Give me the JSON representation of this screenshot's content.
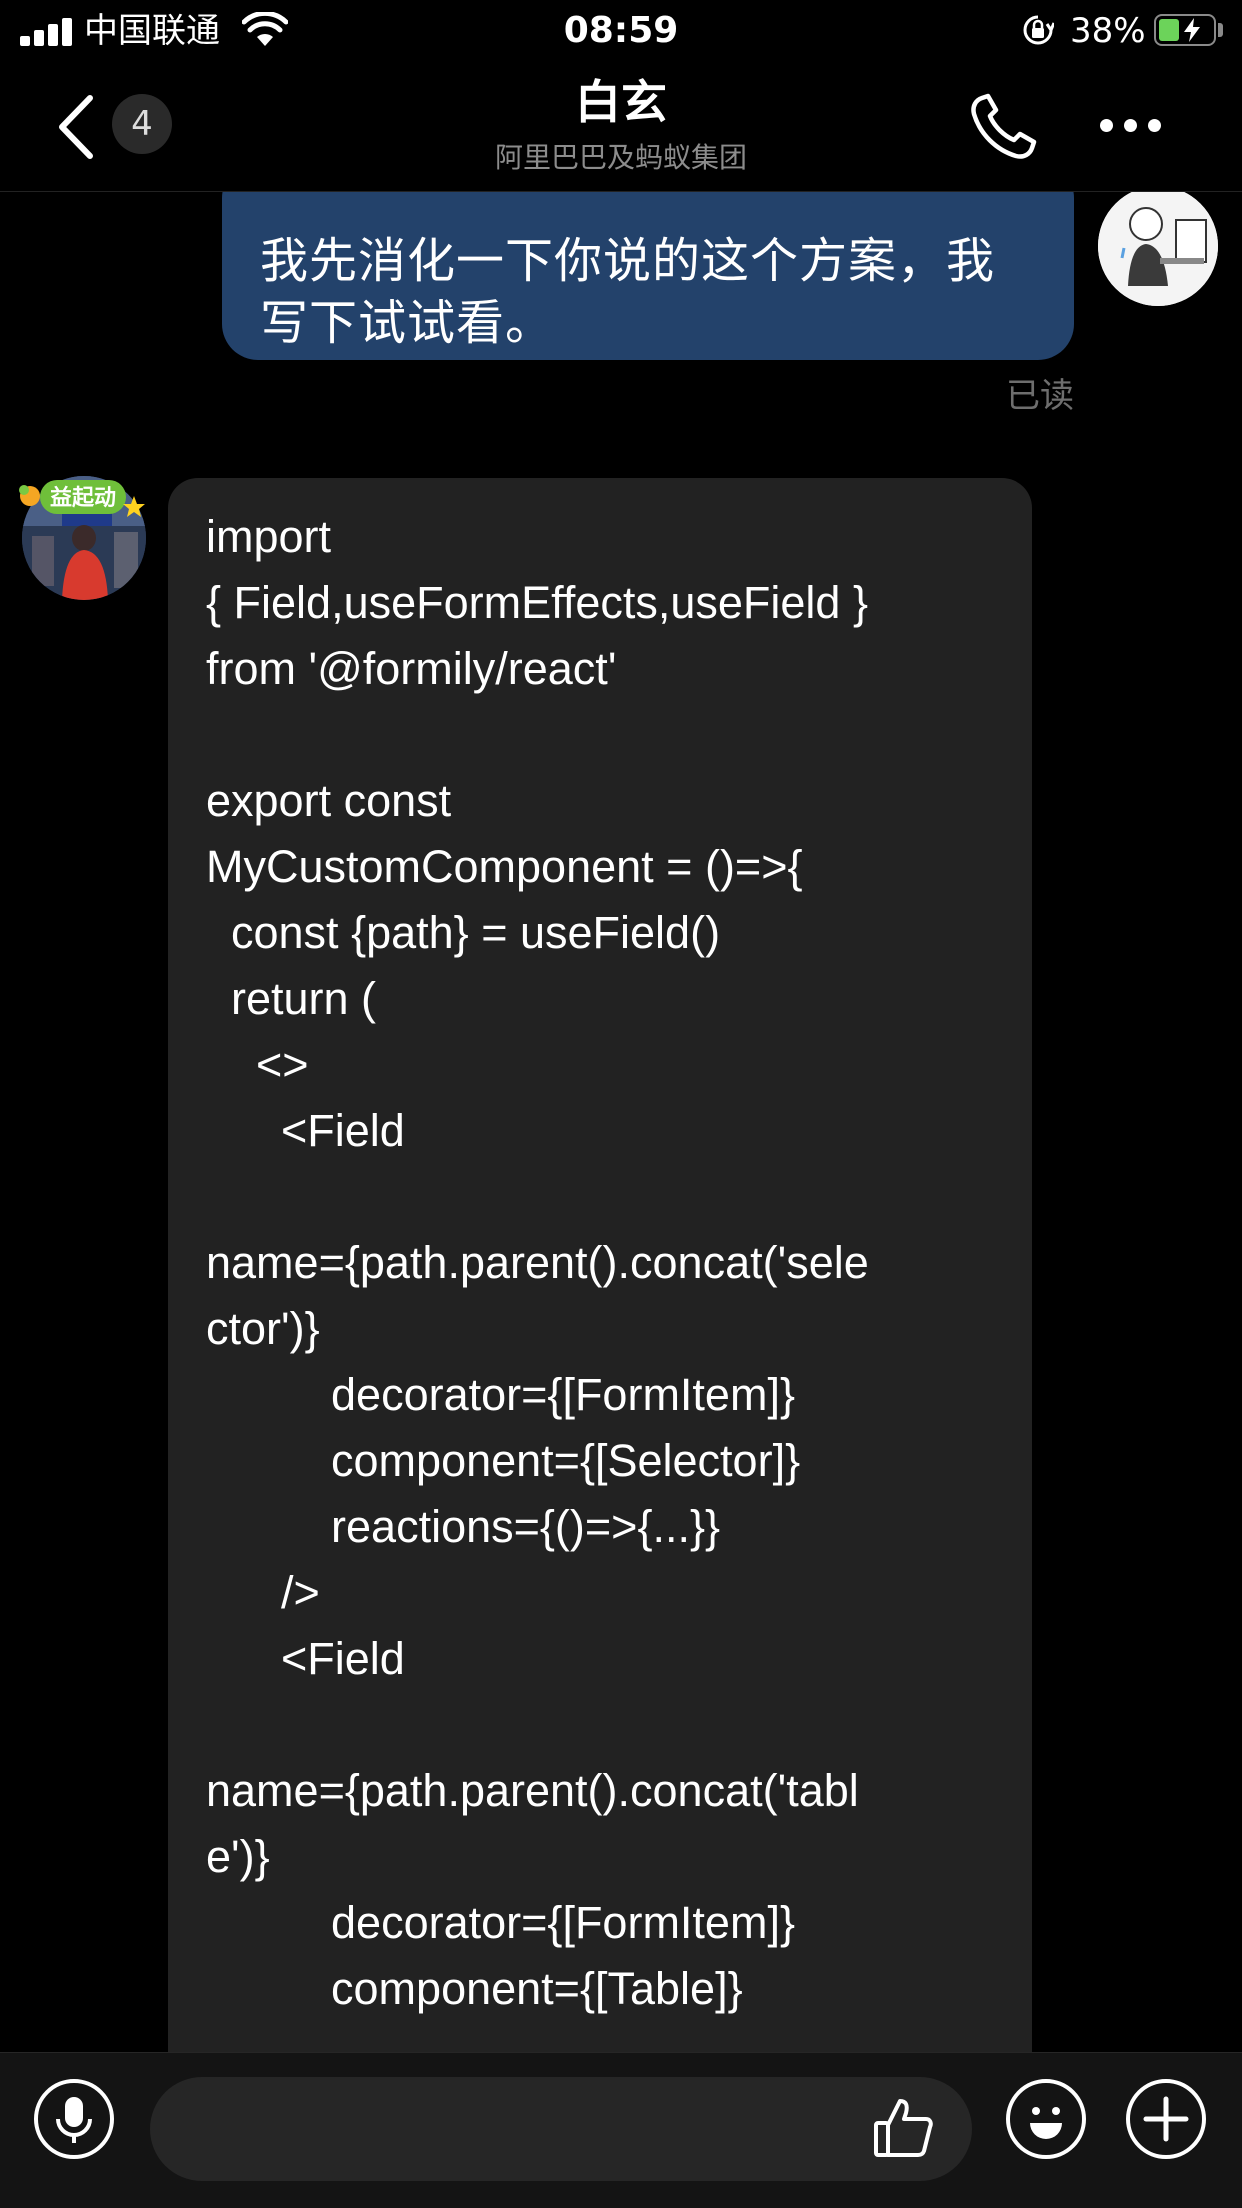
{
  "status_bar": {
    "carrier": "中国联通",
    "time": "08:59",
    "battery_percent": "38%",
    "battery_level": 0.38,
    "icons": [
      "signal-icon",
      "wifi-icon",
      "rotation-lock-icon",
      "battery-charging-icon"
    ]
  },
  "nav": {
    "back_count": "4",
    "title": "白玄",
    "subtitle": "阿里巴巴及蚂蚁集团",
    "icons": [
      "back-chevron-icon",
      "phone-icon",
      "more-icon"
    ]
  },
  "messages": {
    "sent": {
      "text": "我先消化一下你说的这个方案，我写下试试看。",
      "receipt": "已读"
    },
    "received": {
      "sticker_text": "益起动",
      "code_lines": [
        "import",
        "{ Field,useFormEffects,useField }",
        "from '@formily/react'",
        "",
        "export const",
        "MyCustomComponent = ()=>{",
        "  const {path} = useField()",
        "  return (",
        "    <>",
        "      <Field",
        "",
        "name={path.parent().concat('sele",
        "ctor')}",
        "          decorator={[FormItem]}",
        "          component={[Selector]}",
        "          reactions={()=>{...}}",
        "      />",
        "      <Field",
        "",
        "name={path.parent().concat('tabl",
        "e')}",
        "          decorator={[FormItem]}",
        "          component={[Table]}"
      ]
    }
  },
  "input_bar": {
    "icons": [
      "microphone-icon",
      "thumbs-up-icon",
      "emoji-icon",
      "plus-icon"
    ]
  },
  "colors": {
    "background": "#000000",
    "sent_bubble": "#23426b",
    "received_bubble": "#222222",
    "subtitle": "#8c8c8c",
    "battery_fill": "#6cd35a"
  }
}
